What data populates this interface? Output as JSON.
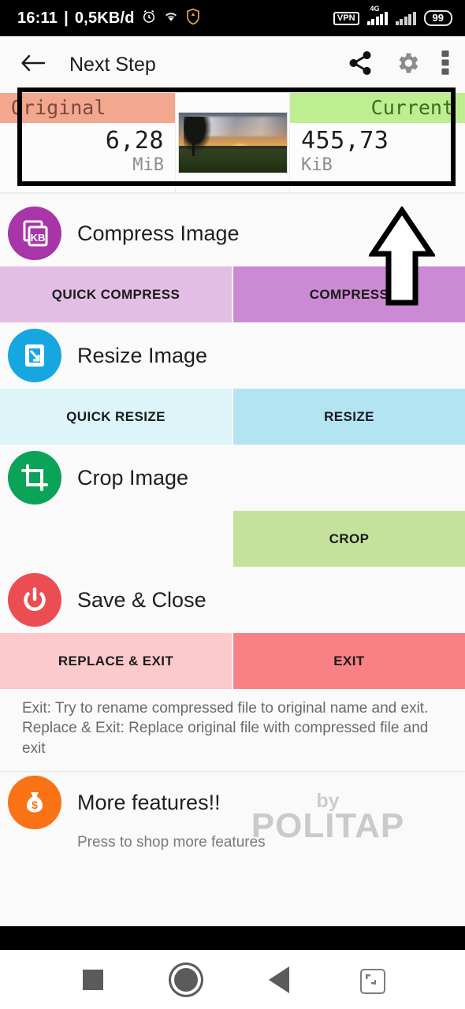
{
  "statusbar": {
    "time": "16:11",
    "separator": "|",
    "data_rate": "0,5KB/d",
    "alarm_icon": "alarm-clock-icon",
    "wifi_icon": "wifi-icon",
    "shield_icon": "brave-shield-icon",
    "vpn_label": "VPN",
    "network_label": "4G",
    "signal_icon": "signal-bars-icon",
    "signal_icon_2": "signal-bars-secondary-icon",
    "battery_level": "99"
  },
  "appbar": {
    "back_icon": "back-arrow-icon",
    "title": "Next Step",
    "share_icon": "share-icon",
    "settings_icon": "gear-icon",
    "overflow_icon": "more-vertical-icon"
  },
  "compare": {
    "original_label": "Original",
    "original_value": "6,28",
    "original_unit": "MiB",
    "thumbnail_name": "sunset-field-thumbnail",
    "current_label": "Current",
    "current_value": "455,73",
    "current_unit": "KiB",
    "highlight": "#000000",
    "original_bg": "#f2a78e",
    "current_bg": "#bdee90"
  },
  "sections": [
    {
      "key": "compress",
      "title": "Compress Image",
      "icon": "kb-file-icon",
      "icon_bg": "#a836a8",
      "buttons": [
        {
          "label": "QUICK COMPRESS",
          "bg": "#e2bde4",
          "blank": false
        },
        {
          "label": "COMPRESS",
          "bg": "#cb8ad3",
          "blank": false
        }
      ]
    },
    {
      "key": "resize",
      "title": "Resize Image",
      "icon": "resize-arrow-icon",
      "icon_bg": "#17a7e0",
      "buttons": [
        {
          "label": "QUICK RESIZE",
          "bg": "#ddf4f8",
          "blank": false
        },
        {
          "label": "RESIZE",
          "bg": "#b3e4f2",
          "blank": false
        }
      ]
    },
    {
      "key": "crop",
      "title": "Crop Image",
      "icon": "crop-icon",
      "icon_bg": "#0aa358",
      "buttons": [
        {
          "label": "",
          "bg": "#fafafa",
          "blank": true
        },
        {
          "label": "CROP",
          "bg": "#c4e29c",
          "blank": false
        }
      ]
    },
    {
      "key": "save_close",
      "title": "Save & Close",
      "icon": "power-icon",
      "icon_bg": "#ec4d52",
      "buttons": [
        {
          "label": "REPLACE & EXIT",
          "bg": "#fcc9cd",
          "blank": false
        },
        {
          "label": "EXIT",
          "bg": "#f98185",
          "blank": false
        }
      ]
    }
  ],
  "note": {
    "line1": "Exit: Try to rename compressed file to original name and exit.",
    "line2": "Replace & Exit: Replace original file with compressed file and exit"
  },
  "watermark": {
    "by": "by",
    "brand": "POLITAP"
  },
  "more": {
    "title": "More features!!",
    "icon": "money-bag-icon",
    "icon_bg": "#f97316",
    "subtitle": "Press to shop more features"
  },
  "annotation": {
    "arrow": "up-arrow-annotation"
  },
  "navbar": {
    "recents_icon": "recents-square-icon",
    "home_icon": "home-circle-icon",
    "back_icon": "back-triangle-icon",
    "fullscreen_icon": "expand-screen-icon"
  }
}
